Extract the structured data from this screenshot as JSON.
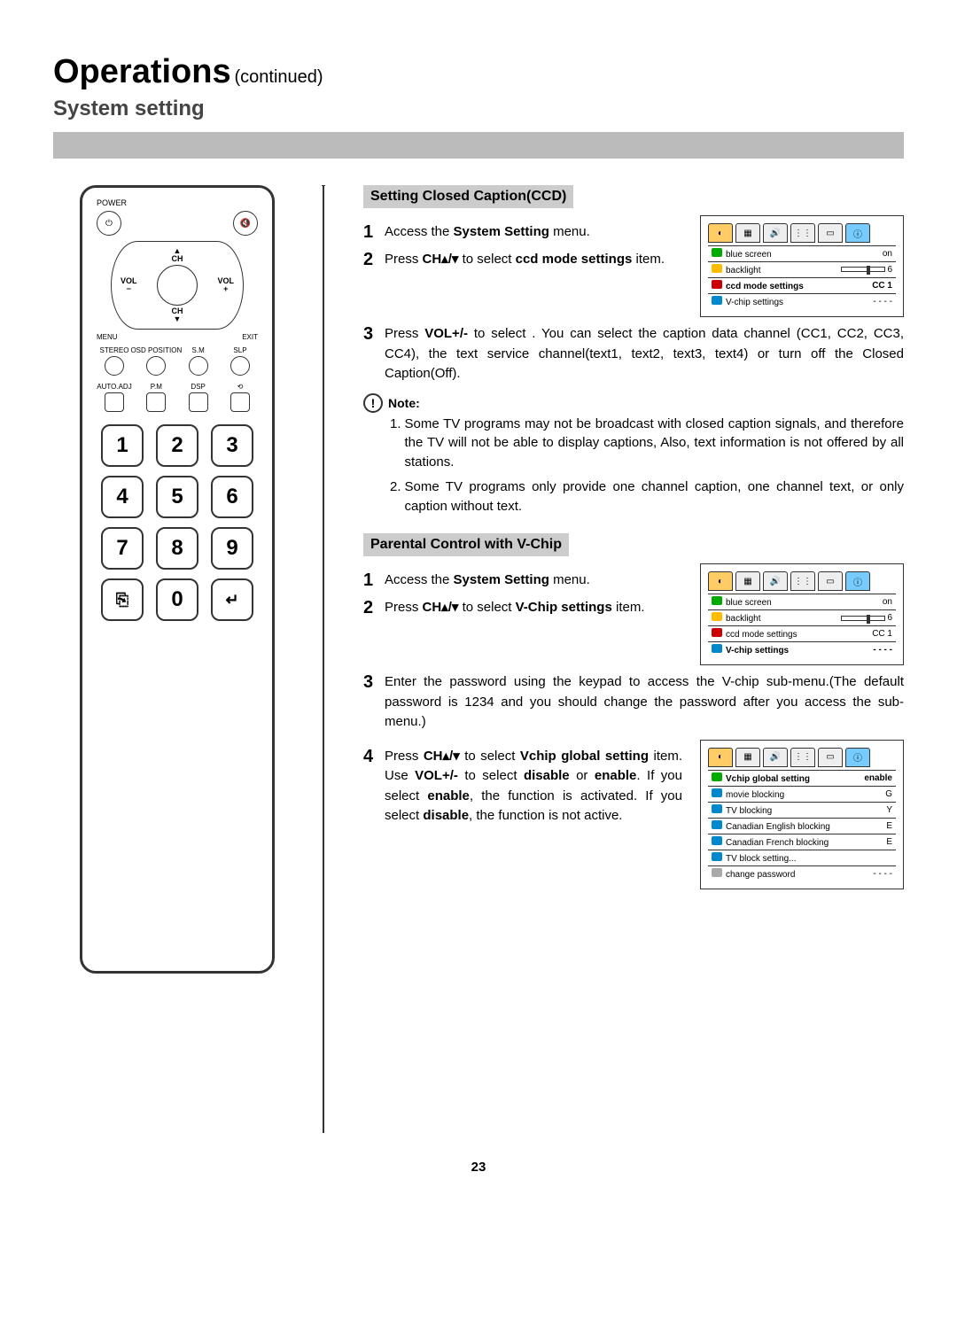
{
  "header": {
    "title": "Operations",
    "continued": "(continued)",
    "subtitle": "System setting"
  },
  "remote": {
    "power": "POWER",
    "mute_icon": "🔇",
    "ch_up": "CH",
    "ch_dn": "CH",
    "vol_l": "VOL",
    "vol_l_sym": "−",
    "vol_r": "VOL",
    "vol_r_sym": "+",
    "menu": "MENU",
    "exit": "EXIT",
    "row_labels": [
      "STEREO",
      "OSD POSITION",
      "S.M",
      "SLP"
    ],
    "row2_labels": [
      "AUTO.ADJ",
      "P.M",
      "DSP",
      ""
    ],
    "keys": [
      "1",
      "2",
      "3",
      "4",
      "5",
      "6",
      "7",
      "8",
      "9",
      "⎘",
      "0",
      "↵"
    ]
  },
  "section1": {
    "heading": "Setting Closed Caption(CCD)",
    "s1_pre": "Access the ",
    "s1_b": "System Setting",
    "s1_post": " menu.",
    "s2_pre": "Press ",
    "s2_b1": "CH▴/▾",
    "s2_mid": " to select ",
    "s2_b2": "ccd mode settings",
    "s2_post": " item.",
    "s3_pre": "Press ",
    "s3_b": "VOL+/-",
    "s3_post": " to select . You can select the caption data channel (CC1, CC2, CC3, CC4), the text service channel(text1, text2, text3, text4) or turn off the Closed Caption(Off).",
    "note_label": "Note",
    "note1": "Some TV programs may not be broadcast with closed caption signals, and therefore the TV will not be able to display captions, Also, text information is not offered by all stations.",
    "note2": "Some TV programs only provide one channel caption, one channel text, or only caption without text."
  },
  "osd1": {
    "r1l": "blue screen",
    "r1v": "on",
    "r2l": "backlight",
    "r2v": "6",
    "r3l": "ccd mode settings",
    "r3v": "CC 1",
    "r4l": "V-chip settings",
    "r4v": "- - - -"
  },
  "section2": {
    "heading": "Parental Control with V-Chip",
    "s1_pre": "Access the ",
    "s1_b": "System Setting",
    "s1_post": " menu.",
    "s2_pre": "Press ",
    "s2_b1": "CH▴/▾",
    "s2_mid": " to select ",
    "s2_b2": "V-Chip settings",
    "s2_post": " item.",
    "s3": "Enter the password using the keypad to access the V-chip sub-menu.(The default password is 1234 and you should  change the password after you access the  sub-menu.)",
    "s4_pre": "Press ",
    "s4_b1": "CH▴/▾",
    "s4_mid1": " to select ",
    "s4_b2": "Vchip global setting",
    "s4_mid2": " item. Use ",
    "s4_b3": "VOL+/-",
    "s4_mid3": " to select ",
    "s4_b4": "disable",
    "s4_mid4": " or ",
    "s4_b5": "enable",
    "s4_mid5": ". If you select ",
    "s4_b6": "enable",
    "s4_mid6": ", the function is activated. If you select ",
    "s4_b7": "disable",
    "s4_post": ", the function is not active."
  },
  "osd2": {
    "r1l": "blue screen",
    "r1v": "on",
    "r2l": "backlight",
    "r2v": "6",
    "r3l": "ccd mode settings",
    "r3v": "CC 1",
    "r4l": "V-chip settings",
    "r4v": "- - - -"
  },
  "osd3": {
    "r1l": "Vchip global setting",
    "r1v": "enable",
    "r2l": "movie blocking",
    "r2v": "G",
    "r3l": "TV blocking",
    "r3v": "Y",
    "r4l": "Canadian English blocking",
    "r4v": "E",
    "r5l": "Canadian French blocking",
    "r5v": "E",
    "r6l": "TV block setting...",
    "r6v": "",
    "r7l": "change password",
    "r7v": "- - - -"
  },
  "page_number": "23"
}
